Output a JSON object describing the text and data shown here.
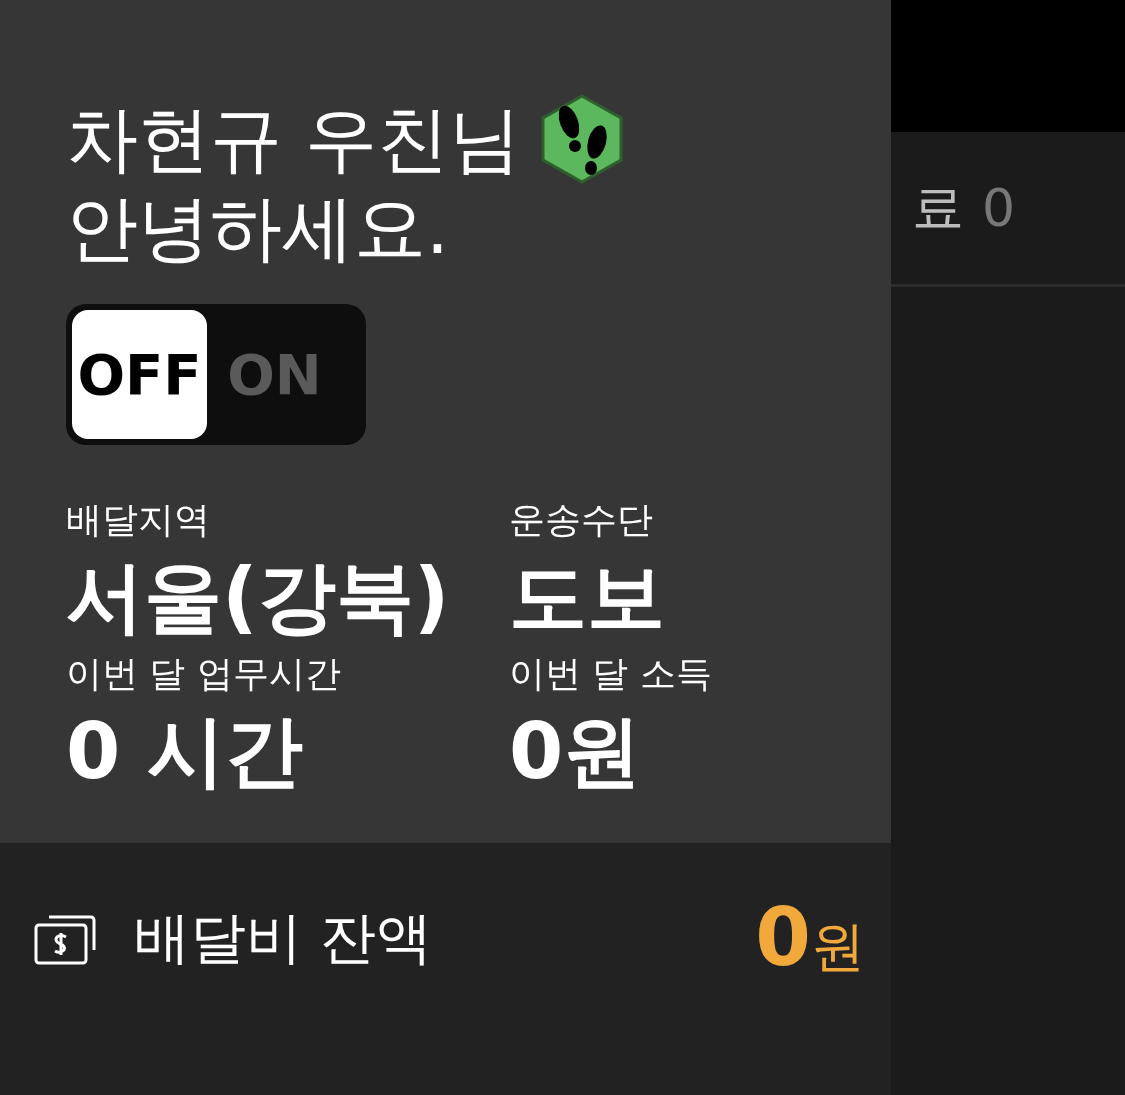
{
  "drawer": {
    "greeting_name": "차현규 우친님",
    "greeting": "안녕하세요.",
    "toggle": {
      "off_label": "OFF",
      "on_label": "ON",
      "on": false
    },
    "stats": [
      {
        "label": "배달지역",
        "value": "서울(강북)"
      },
      {
        "label": "운송수단",
        "value": "도보"
      },
      {
        "label": "이번 달 업무시간",
        "value": "0 시간"
      },
      {
        "label": "이번 달 소득",
        "value": "0원"
      }
    ],
    "balance": {
      "label": "배달비 잔액",
      "amount": "0",
      "unit": "원"
    }
  },
  "background": {
    "status_label": "료",
    "status_count": "0"
  }
}
